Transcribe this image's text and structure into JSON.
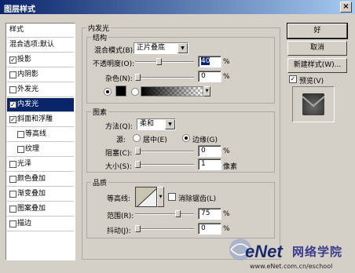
{
  "window": {
    "title": "图层样式",
    "close": "×"
  },
  "styles_list": {
    "header": "样式",
    "blend_options": "混合选项:默认",
    "items": [
      {
        "label": "投影",
        "checked": true,
        "sub": false,
        "selected": false
      },
      {
        "label": "内阴影",
        "checked": false,
        "sub": false,
        "selected": false
      },
      {
        "label": "外发光",
        "checked": false,
        "sub": false,
        "selected": false
      },
      {
        "label": "内发光",
        "checked": true,
        "sub": false,
        "selected": true
      },
      {
        "label": "斜面和浮雕",
        "checked": true,
        "sub": false,
        "selected": false
      },
      {
        "label": "等高线",
        "checked": false,
        "sub": true,
        "selected": false
      },
      {
        "label": "纹理",
        "checked": false,
        "sub": true,
        "selected": false
      },
      {
        "label": "光泽",
        "checked": false,
        "sub": false,
        "selected": false
      },
      {
        "label": "颜色叠加",
        "checked": false,
        "sub": false,
        "selected": false
      },
      {
        "label": "渐变叠加",
        "checked": false,
        "sub": false,
        "selected": false
      },
      {
        "label": "图案叠加",
        "checked": false,
        "sub": false,
        "selected": false
      },
      {
        "label": "描边",
        "checked": false,
        "sub": false,
        "selected": false
      }
    ]
  },
  "inner_glow": {
    "title": "内发光",
    "structure": {
      "title": "结构",
      "blend_mode_label": "混合模式(B):",
      "blend_mode_value": "正片叠底",
      "opacity_label": "不透明度(O):",
      "opacity_value": "40",
      "opacity_unit": "%",
      "opacity_level": 0.4,
      "noise_label": "杂色(N):",
      "noise_value": "0",
      "noise_unit": "%",
      "color": "#000000"
    },
    "elements": {
      "title": "图素",
      "method_label": "方法(Q):",
      "method_value": "柔和",
      "source_label": "源:",
      "source_center": "居中(E)",
      "source_edge": "边缘(G)",
      "choke_label": "阻塞(C):",
      "choke_value": "0",
      "choke_unit": "%",
      "size_label": "大小(S):",
      "size_value": "1",
      "size_unit": "像素"
    },
    "quality": {
      "title": "品质",
      "contour_label": "等高线:",
      "antialias_label": "消除锯齿(L)",
      "range_label": "范围(R):",
      "range_value": "75",
      "range_unit": "%",
      "range_level": 0.75,
      "jitter_label": "抖动(J):",
      "jitter_value": "0",
      "jitter_unit": "%"
    }
  },
  "buttons": {
    "ok": "好",
    "cancel": "取消",
    "new_style": "新建样式(W)...",
    "preview": "预览(V)"
  },
  "watermark": {
    "brand": "eNet",
    "cn": "网络学院",
    "url": "www.eNet.com.cn/eschool"
  }
}
